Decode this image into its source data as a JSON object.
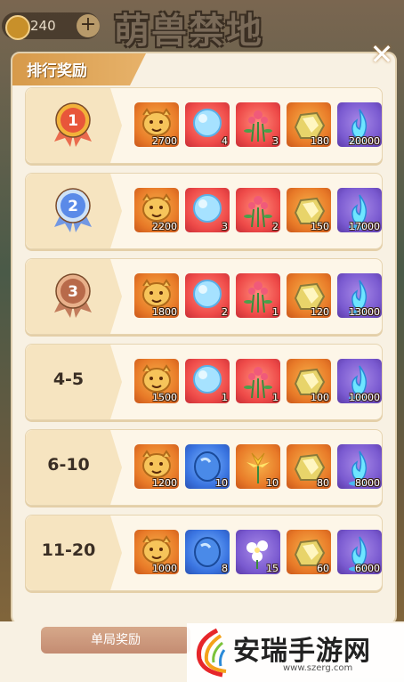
{
  "hud": {
    "currency_value": "240",
    "plus_label": "+",
    "game_title": "萌兽禁地"
  },
  "panel": {
    "title": "排行奖励",
    "close_label": "✕"
  },
  "rows": [
    {
      "rank": "1",
      "medal": "gold",
      "items": [
        {
          "icon": "lion-icon",
          "quality": "orange",
          "count": "2700"
        },
        {
          "icon": "orb-icon",
          "quality": "red",
          "count": "4"
        },
        {
          "icon": "flower-icon",
          "quality": "red",
          "count": "3"
        },
        {
          "icon": "rock-icon",
          "quality": "orange",
          "count": "180"
        },
        {
          "icon": "spirit-flame-icon",
          "quality": "purple",
          "count": "20000"
        }
      ]
    },
    {
      "rank": "2",
      "medal": "silver",
      "items": [
        {
          "icon": "lion-icon",
          "quality": "orange",
          "count": "2200"
        },
        {
          "icon": "orb-icon",
          "quality": "red",
          "count": "3"
        },
        {
          "icon": "flower-icon",
          "quality": "red",
          "count": "2"
        },
        {
          "icon": "rock-icon",
          "quality": "orange",
          "count": "150"
        },
        {
          "icon": "spirit-flame-icon",
          "quality": "purple",
          "count": "17000"
        }
      ]
    },
    {
      "rank": "3",
      "medal": "bronze",
      "items": [
        {
          "icon": "lion-icon",
          "quality": "orange",
          "count": "1800"
        },
        {
          "icon": "orb-icon",
          "quality": "red",
          "count": "2"
        },
        {
          "icon": "flower-icon",
          "quality": "red",
          "count": "1"
        },
        {
          "icon": "rock-icon",
          "quality": "orange",
          "count": "120"
        },
        {
          "icon": "spirit-flame-icon",
          "quality": "purple",
          "count": "13000"
        }
      ]
    },
    {
      "rank": "4-5",
      "medal": "",
      "items": [
        {
          "icon": "lion-icon",
          "quality": "orange",
          "count": "1500"
        },
        {
          "icon": "orb-icon",
          "quality": "red",
          "count": "1"
        },
        {
          "icon": "flower-icon",
          "quality": "red",
          "count": "1"
        },
        {
          "icon": "rock-icon",
          "quality": "orange",
          "count": "100"
        },
        {
          "icon": "spirit-flame-icon",
          "quality": "purple",
          "count": "10000"
        }
      ]
    },
    {
      "rank": "6-10",
      "medal": "",
      "items": [
        {
          "icon": "lion-icon",
          "quality": "orange",
          "count": "1200"
        },
        {
          "icon": "egg-stone-icon",
          "quality": "blue",
          "count": "10"
        },
        {
          "icon": "lily-icon",
          "quality": "orange",
          "count": "10"
        },
        {
          "icon": "rock-icon",
          "quality": "orange",
          "count": "80"
        },
        {
          "icon": "spirit-flame-icon",
          "quality": "purple",
          "count": "8000"
        }
      ]
    },
    {
      "rank": "11-20",
      "medal": "",
      "items": [
        {
          "icon": "lion-icon",
          "quality": "orange",
          "count": "1000"
        },
        {
          "icon": "egg-stone-icon",
          "quality": "blue",
          "count": "8"
        },
        {
          "icon": "white-flower-icon",
          "quality": "purple",
          "count": "15"
        },
        {
          "icon": "rock-icon",
          "quality": "orange",
          "count": "60"
        },
        {
          "icon": "spirit-flame-icon",
          "quality": "purple",
          "count": "6000"
        }
      ]
    }
  ],
  "bottom": {
    "single_button": "单局奖励"
  },
  "watermark": {
    "title": "安瑞手游网",
    "url": "www.szerg.com"
  },
  "colors": {
    "orange": "#e87a28",
    "red": "#ee4a48",
    "blue": "#3a74e0",
    "purple": "#7a5ad0",
    "panel": "#f8f1e3"
  }
}
